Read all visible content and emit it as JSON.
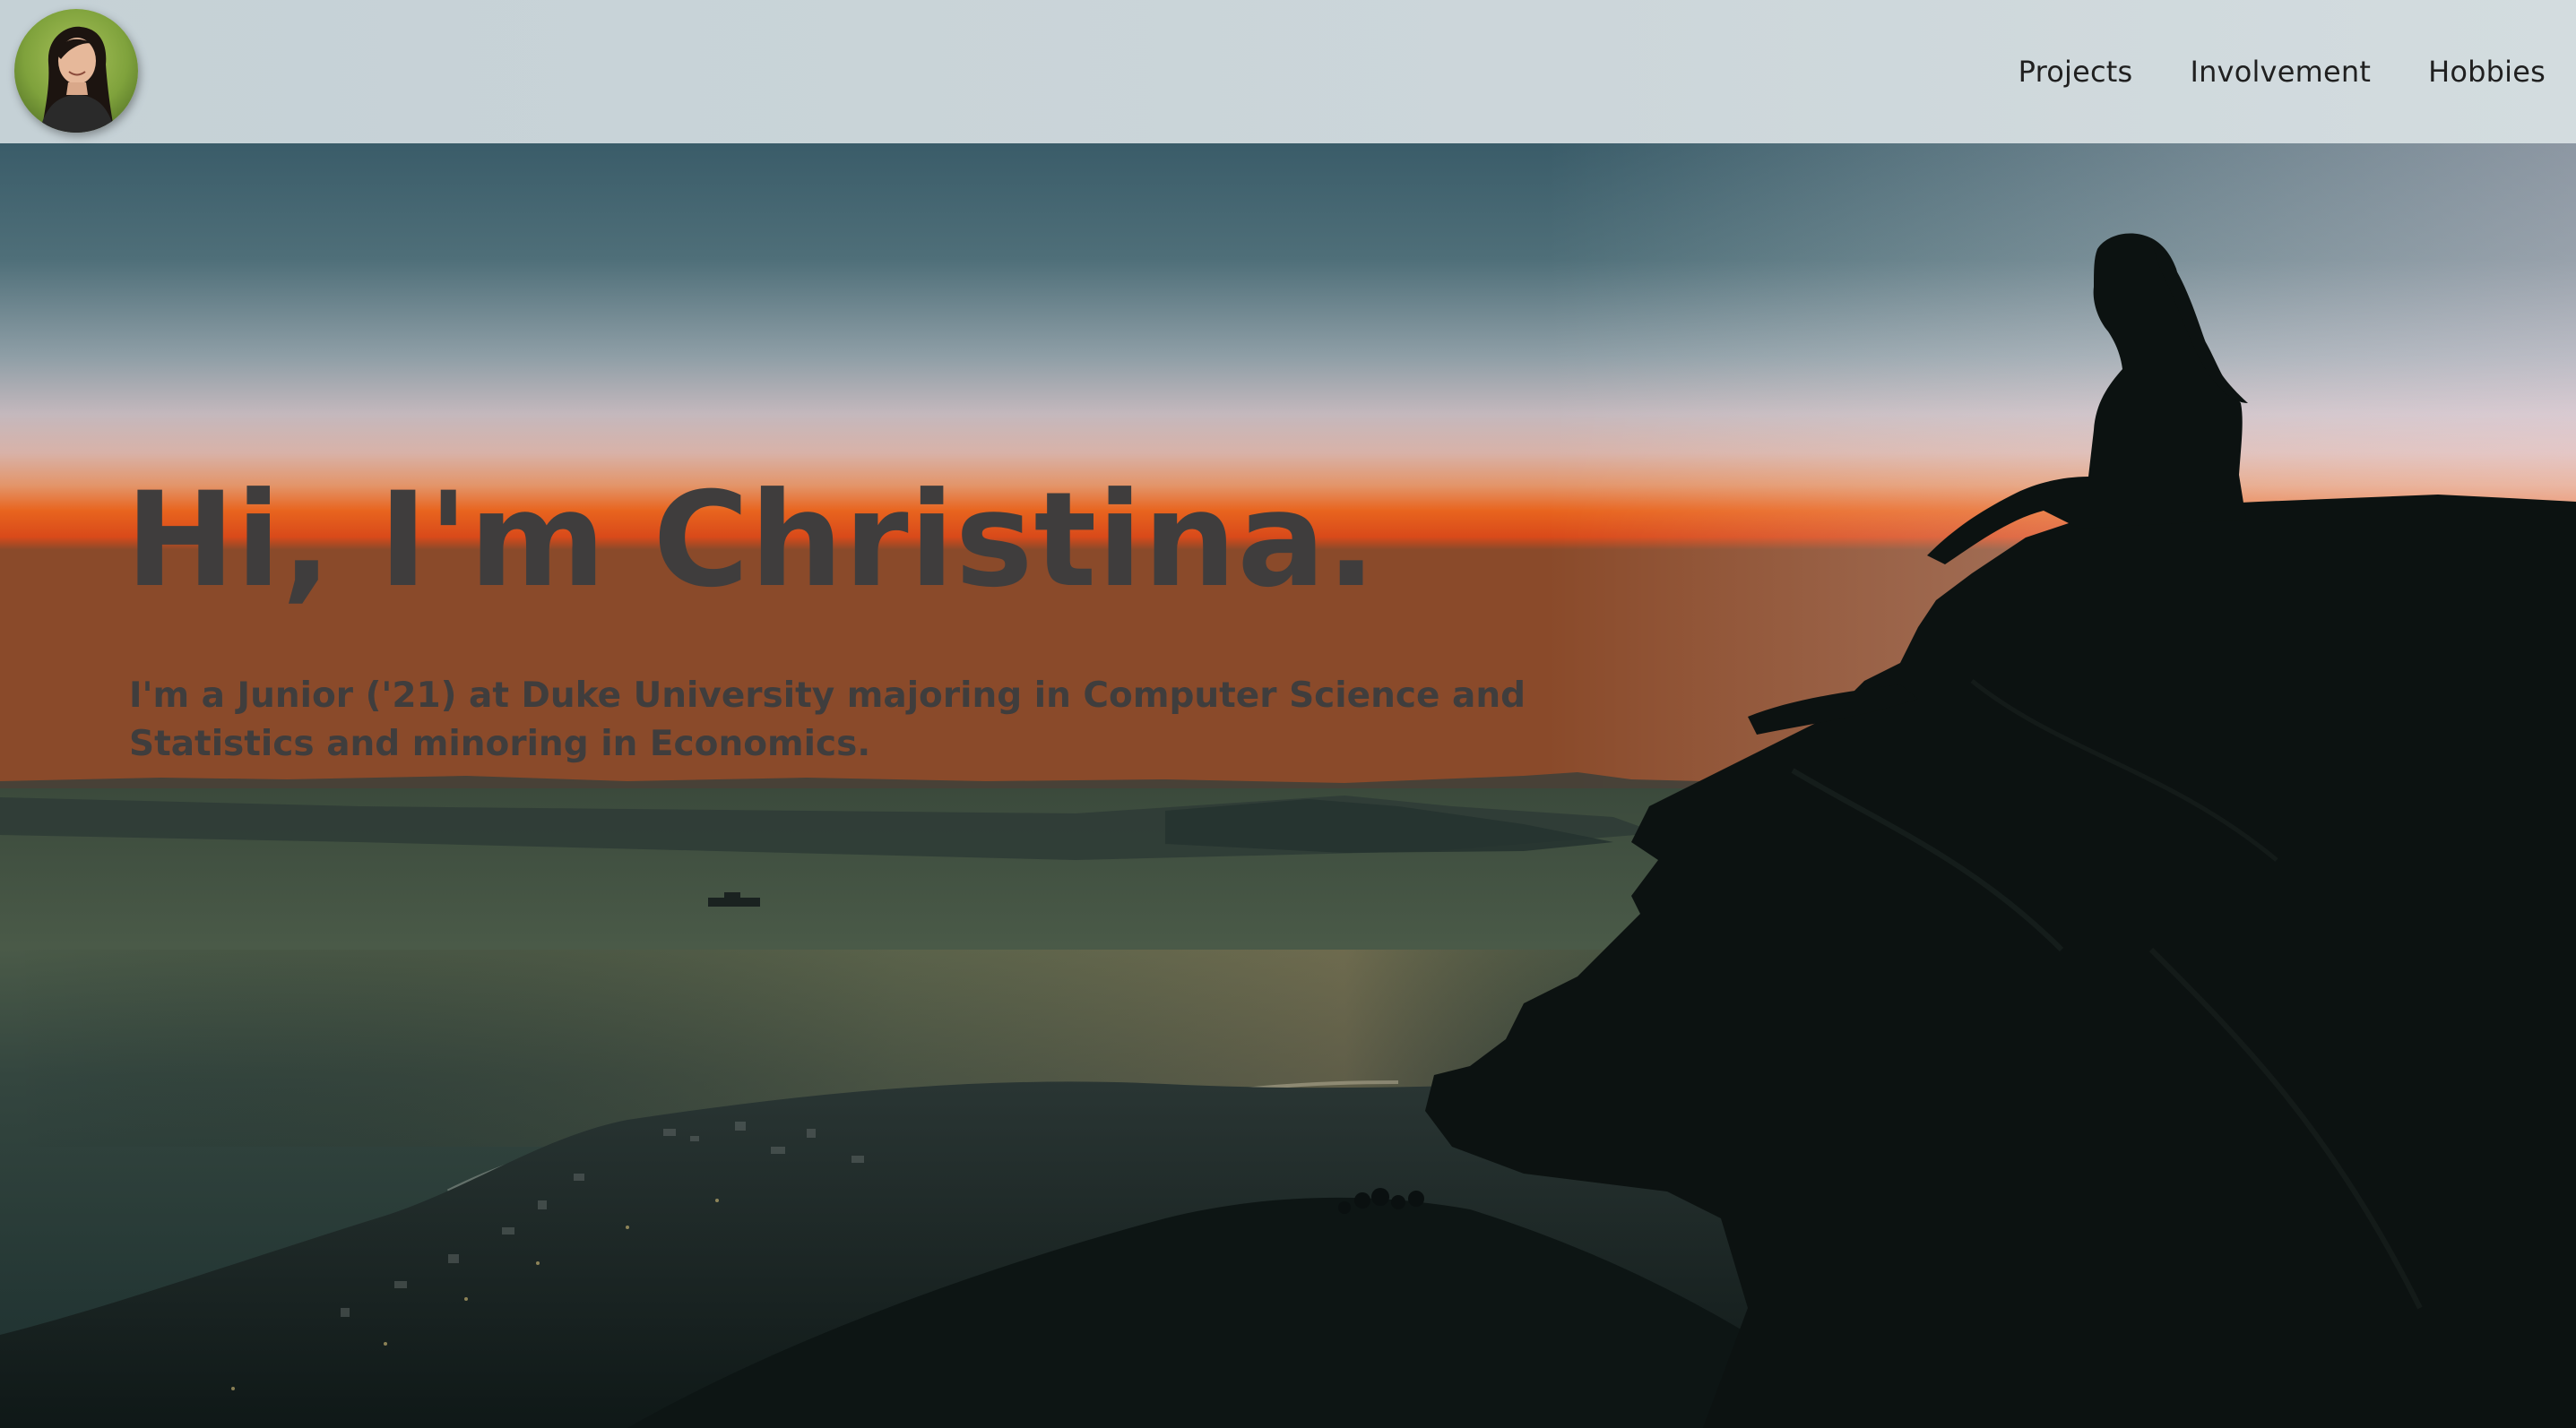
{
  "header": {
    "avatar_alt": "Christina",
    "nav": [
      {
        "label": "Projects"
      },
      {
        "label": "Involvement"
      },
      {
        "label": "Hobbies"
      }
    ]
  },
  "hero": {
    "title": "Hi, I'm Christina.",
    "subtitle": "I'm a Junior ('21) at Duke University majoring in Computer Science and Statistics and minoring in Economics."
  },
  "colors": {
    "header_bg": "#ccd6da",
    "text": "#3f3d3d",
    "nav_text": "#202020",
    "sunset_orange": "#e8641e",
    "sky_top": "#3b5f6b"
  }
}
